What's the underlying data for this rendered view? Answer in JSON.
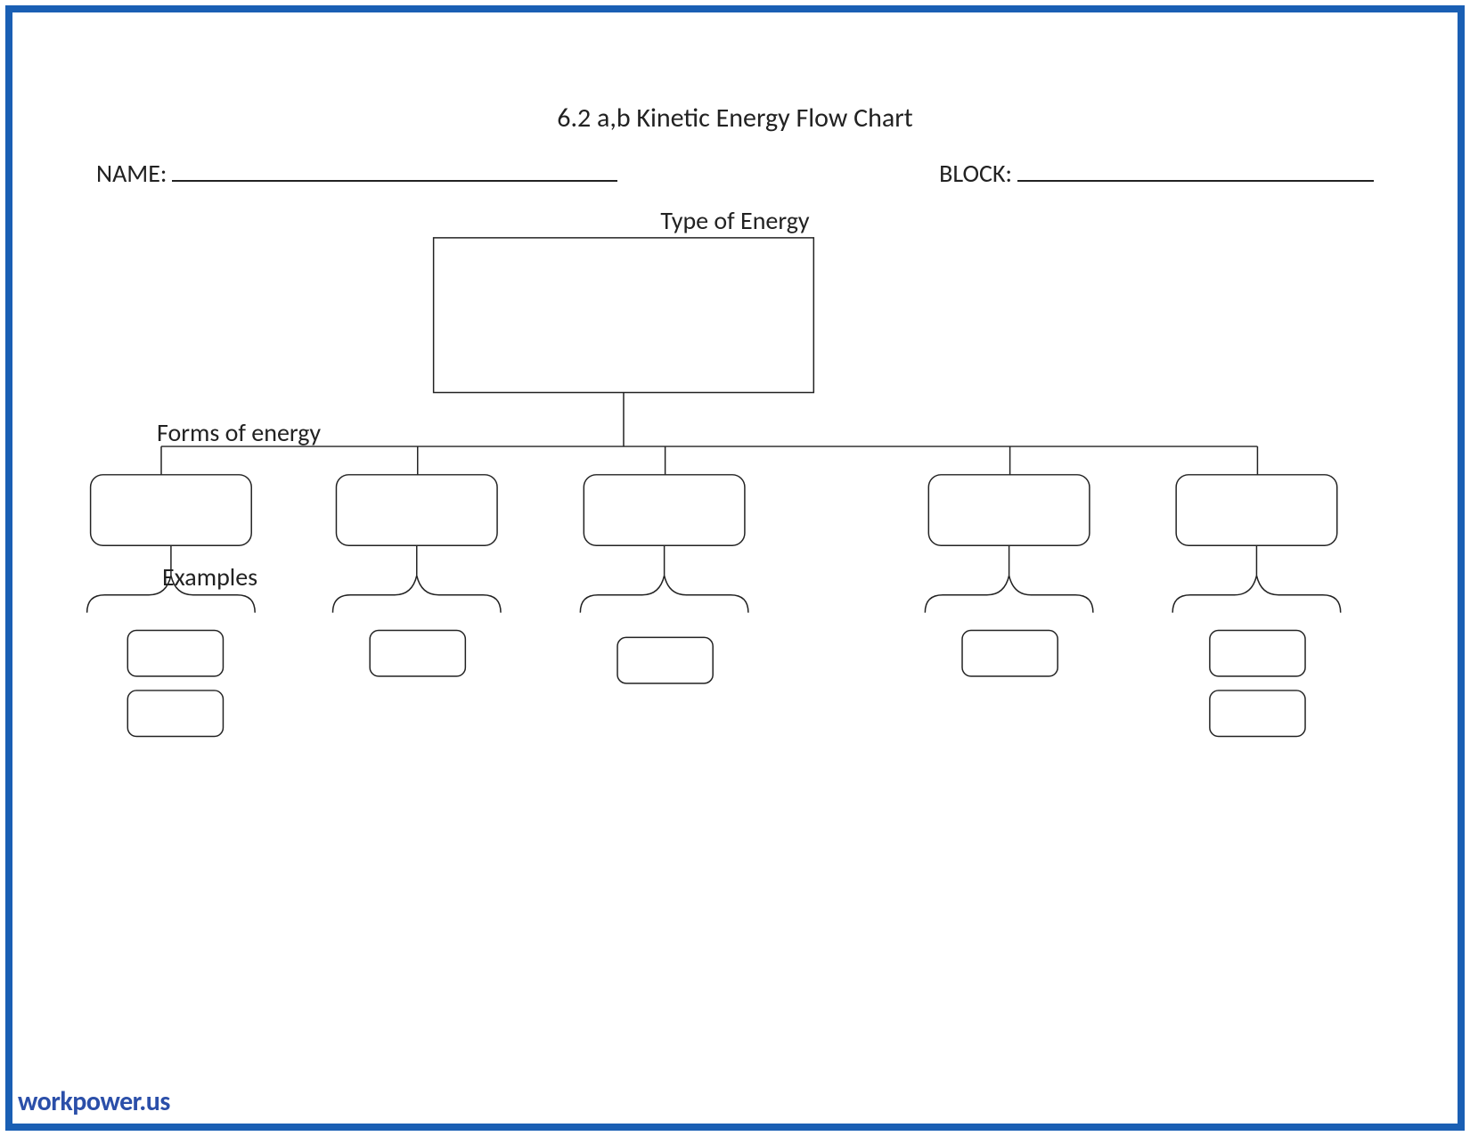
{
  "title": "6.2 a,b Kinetic Energy Flow Chart",
  "labels": {
    "name": "NAME:",
    "block": "BLOCK:",
    "type_of_energy": "Type of Energy",
    "forms_of_energy": "Forms of energy",
    "examples": "Examples"
  },
  "watermark": "workpower.us",
  "chart_data": {
    "type": "tree",
    "root": {
      "label": "Type of Energy",
      "value": ""
    },
    "children_label": "Forms of energy",
    "children": [
      {
        "value": "",
        "examples": [
          "",
          ""
        ]
      },
      {
        "value": "",
        "examples": [
          ""
        ]
      },
      {
        "value": "",
        "examples": [
          ""
        ]
      },
      {
        "value": "",
        "examples": [
          ""
        ]
      },
      {
        "value": "",
        "examples": [
          "",
          ""
        ]
      }
    ],
    "examples_label": "Examples"
  }
}
